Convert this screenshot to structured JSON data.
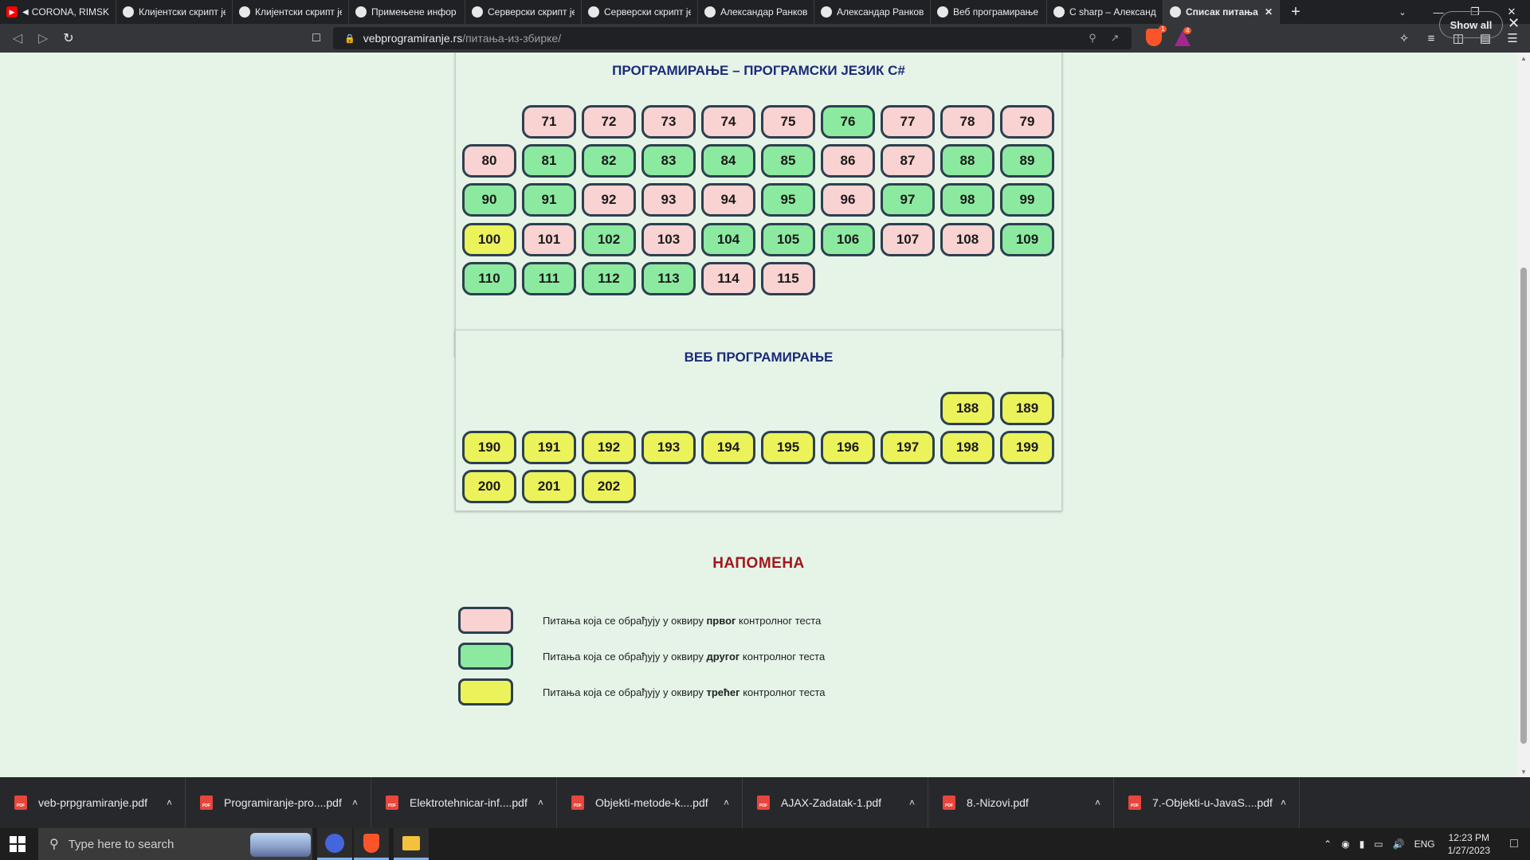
{
  "browser": {
    "tabs": [
      {
        "title": "CORONA, RIMSKI",
        "icon": "youtube-icon",
        "audio": true
      },
      {
        "title": "Клијентски скрипт је",
        "icon": "person-icon"
      },
      {
        "title": "Клијентски скрипт је",
        "icon": "person-icon"
      },
      {
        "title": "Примењене инфор",
        "icon": "person-icon"
      },
      {
        "title": "Серверски скрипт је",
        "icon": "person-icon"
      },
      {
        "title": "Серверски скрипт је",
        "icon": "person-icon"
      },
      {
        "title": "Александар Ранков",
        "icon": "person-icon"
      },
      {
        "title": "Александар Ранков",
        "icon": "person-icon"
      },
      {
        "title": "Веб програмирање",
        "icon": "person-icon"
      },
      {
        "title": "C sharp – Александа",
        "icon": "person-icon"
      },
      {
        "title": "Списак питања",
        "icon": "person-icon",
        "active": true
      }
    ],
    "new_tab_label": "+",
    "url_domain": "vebprogramiranje.rs",
    "url_path": "/питања-из-збирке/",
    "shield_badge": "1",
    "rewards_badge": "4"
  },
  "section1": {
    "title": "ПРОГРАМИРАЊЕ – ПРОГРАМСКИ ЈЕЗИК C#",
    "rows": [
      [
        null,
        {
          "n": "71",
          "c": 1
        },
        {
          "n": "72",
          "c": 1
        },
        {
          "n": "73",
          "c": 1
        },
        {
          "n": "74",
          "c": 1
        },
        {
          "n": "75",
          "c": 1
        },
        {
          "n": "76",
          "c": 2
        },
        {
          "n": "77",
          "c": 1
        },
        {
          "n": "78",
          "c": 1
        },
        {
          "n": "79",
          "c": 1
        }
      ],
      [
        {
          "n": "80",
          "c": 1
        },
        {
          "n": "81",
          "c": 2
        },
        {
          "n": "82",
          "c": 2
        },
        {
          "n": "83",
          "c": 2
        },
        {
          "n": "84",
          "c": 2
        },
        {
          "n": "85",
          "c": 2
        },
        {
          "n": "86",
          "c": 1
        },
        {
          "n": "87",
          "c": 1
        },
        {
          "n": "88",
          "c": 2
        },
        {
          "n": "89",
          "c": 2
        }
      ],
      [
        {
          "n": "90",
          "c": 2
        },
        {
          "n": "91",
          "c": 2
        },
        {
          "n": "92",
          "c": 1
        },
        {
          "n": "93",
          "c": 1
        },
        {
          "n": "94",
          "c": 1
        },
        {
          "n": "95",
          "c": 2
        },
        {
          "n": "96",
          "c": 1
        },
        {
          "n": "97",
          "c": 2
        },
        {
          "n": "98",
          "c": 2
        },
        {
          "n": "99",
          "c": 2
        }
      ],
      [
        {
          "n": "100",
          "c": 3
        },
        {
          "n": "101",
          "c": 1
        },
        {
          "n": "102",
          "c": 2
        },
        {
          "n": "103",
          "c": 1
        },
        {
          "n": "104",
          "c": 2
        },
        {
          "n": "105",
          "c": 2
        },
        {
          "n": "106",
          "c": 2
        },
        {
          "n": "107",
          "c": 1
        },
        {
          "n": "108",
          "c": 1
        },
        {
          "n": "109",
          "c": 2
        }
      ],
      [
        {
          "n": "110",
          "c": 2
        },
        {
          "n": "111",
          "c": 2
        },
        {
          "n": "112",
          "c": 2
        },
        {
          "n": "113",
          "c": 2
        },
        {
          "n": "114",
          "c": 1
        },
        {
          "n": "115",
          "c": 1
        }
      ]
    ]
  },
  "section2": {
    "title": "ВЕБ ПРОГРАМИРАЊЕ",
    "rows": [
      [
        null,
        null,
        null,
        null,
        null,
        null,
        null,
        null,
        {
          "n": "188",
          "c": 3
        },
        {
          "n": "189",
          "c": 3
        }
      ],
      [
        {
          "n": "190",
          "c": 3
        },
        {
          "n": "191",
          "c": 3
        },
        {
          "n": "192",
          "c": 3
        },
        {
          "n": "193",
          "c": 3
        },
        {
          "n": "194",
          "c": 3
        },
        {
          "n": "195",
          "c": 3
        },
        {
          "n": "196",
          "c": 3
        },
        {
          "n": "197",
          "c": 3
        },
        {
          "n": "198",
          "c": 3
        },
        {
          "n": "199",
          "c": 3
        }
      ],
      [
        {
          "n": "200",
          "c": 3
        },
        {
          "n": "201",
          "c": 3
        },
        {
          "n": "202",
          "c": 3
        }
      ]
    ]
  },
  "note": {
    "title": "НАПОМЕНА",
    "legend": [
      {
        "pre": "Питања која се обрађују у оквиру ",
        "bold": "првог",
        "post": " контролног теста",
        "color": "#f9d2d2"
      },
      {
        "pre": "Питања која се обрађују у оквиру ",
        "bold": "другог",
        "post": " контролног теста",
        "color": "#8ceaa0"
      },
      {
        "pre": "Питања која се обрађују у оквиру ",
        "bold": "трећег",
        "post": " контролног теста",
        "color": "#ecf25a"
      }
    ]
  },
  "colors": {
    "first": "#f9d2d2",
    "second": "#8ceaa0",
    "third": "#ecf25a",
    "border": "#2c4050"
  },
  "downloads": {
    "items": [
      "veb-prpgramiranje.pdf",
      "Programiranje-pro....pdf",
      "Elektrotehnicar-inf....pdf",
      "Objekti-metode-k....pdf",
      "AJAX-Zadatak-1.pdf",
      "8.-Nizovi.pdf",
      "7.-Objekti-u-JavaS....pdf"
    ],
    "file_icon_label": "PDF",
    "show_all": "Show all"
  },
  "taskbar": {
    "search_placeholder": "Type here to search",
    "lang": "ENG",
    "time": "12:23 PM",
    "date": "1/27/2023"
  }
}
